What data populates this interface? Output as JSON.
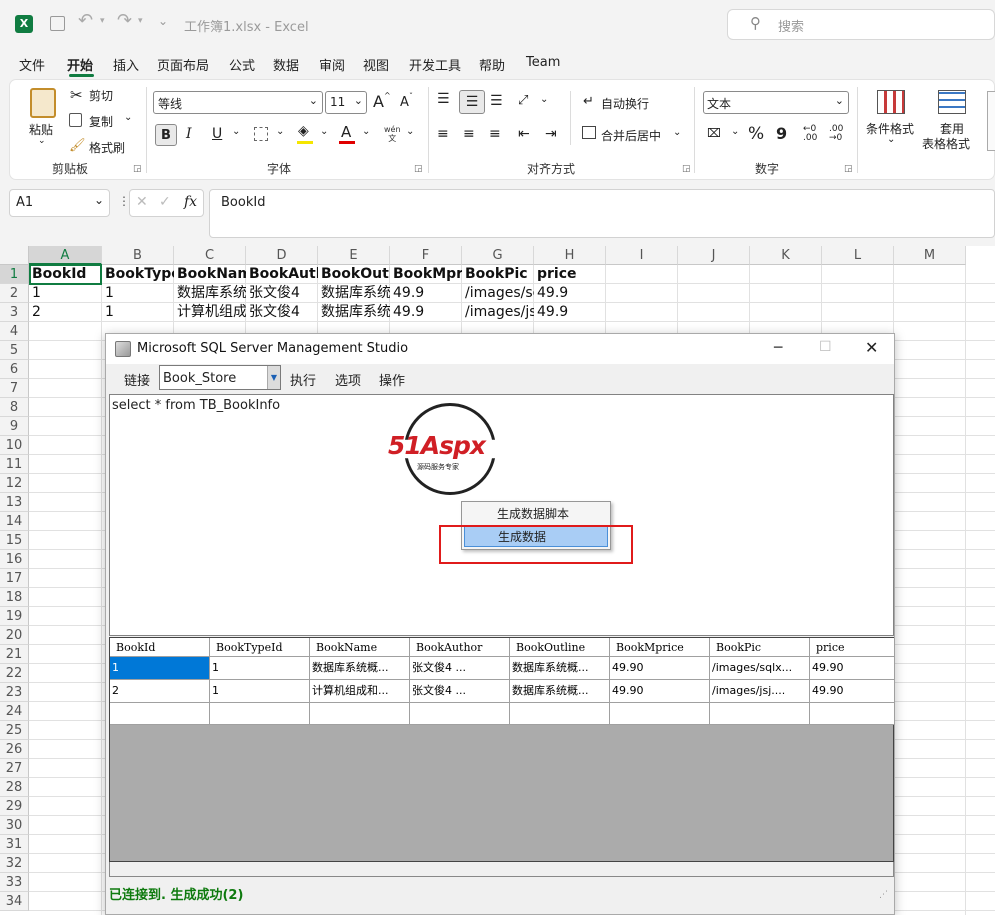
{
  "colors": {
    "excel_green": "#107c41",
    "selection": "#0078d7",
    "status_green": "#0e7a0e",
    "red_box": "#e01b1b"
  },
  "titlebar": {
    "title": "工作簿1.xlsx  -  Excel",
    "search_placeholder": "搜索",
    "icons": [
      "excel-icon",
      "save-icon",
      "undo-icon",
      "redo-icon"
    ]
  },
  "menu": [
    "文件",
    "开始",
    "插入",
    "页面布局",
    "公式",
    "数据",
    "审阅",
    "视图",
    "开发工具",
    "帮助",
    "Team"
  ],
  "ribbon": {
    "clipboard": {
      "paste": "粘贴",
      "cut": "剪切",
      "copy": "复制",
      "format_painter": "格式刷",
      "label": "剪贴板"
    },
    "font": {
      "name": "等线",
      "size": "11",
      "bold": "B",
      "italic": "I",
      "underline": "U",
      "grow": "A",
      "shrink": "A",
      "wen": "wén\n文",
      "label": "字体"
    },
    "align": {
      "wrap": "自动换行",
      "merge": "合并后居中",
      "label": "对齐方式"
    },
    "number": {
      "format": "文本",
      "percent": "%",
      "comma": "9",
      "label": "数字"
    },
    "styles": {
      "cond": "条件格式",
      "table1": "套用",
      "table2": "表格格式"
    }
  },
  "formula_bar": {
    "name_box": "A1",
    "fx": "fx",
    "content": "BookId"
  },
  "sheet": {
    "columns": [
      "A",
      "B",
      "C",
      "D",
      "E",
      "F",
      "G",
      "H",
      "I",
      "J",
      "K",
      "L",
      "M"
    ],
    "rows": [
      "1",
      "2",
      "3",
      "4",
      "5",
      "6",
      "7",
      "8",
      "9",
      "10",
      "11",
      "12",
      "13",
      "14",
      "15",
      "16",
      "17",
      "18",
      "19",
      "20",
      "21",
      "22",
      "23",
      "24",
      "25",
      "26",
      "27",
      "28",
      "29",
      "30",
      "31",
      "32",
      "33",
      "34"
    ],
    "header": [
      "BookId",
      "BookType",
      "BookNam",
      "BookAuth",
      "BookOutli",
      "BookMpri",
      "BookPic",
      "price"
    ],
    "data": [
      [
        "1",
        "1",
        "数据库系统",
        "张文俊4",
        "数据库系统",
        "49.9",
        "/images/sc",
        "49.9"
      ],
      [
        "2",
        "1",
        "计算机组成",
        "张文俊4",
        "数据库系统",
        "49.9",
        "/images/js",
        "49.9"
      ]
    ]
  },
  "ssms": {
    "title": "Microsoft SQL Server Management Studio",
    "toolbar": {
      "connect": "链接",
      "database": "Book_Store",
      "execute": "执行",
      "options": "选项",
      "operate": "操作"
    },
    "query": "select * from TB_BookInfo",
    "logo": {
      "brand": "51Aspx",
      "tagline": "源码服务专家"
    },
    "context_menu": [
      "生成数据脚本",
      "生成数据"
    ],
    "grid": {
      "columns": [
        "BookId",
        "BookTypeId",
        "BookName",
        "BookAuthor",
        "BookOutline",
        "BookMprice",
        "BookPic",
        "price"
      ],
      "rows": [
        [
          "1",
          "1",
          "数据库系统概...",
          "张文俊4        ...",
          "数据库系统概...",
          "49.90",
          "/images/sqlx...",
          "49.90"
        ],
        [
          "2",
          "1",
          "计算机组成和...",
          "张文俊4        ...",
          "数据库系统概...",
          "49.90",
          "/images/jsj....",
          "49.90"
        ]
      ]
    },
    "status": "已连接到. 生成成功(2)"
  }
}
